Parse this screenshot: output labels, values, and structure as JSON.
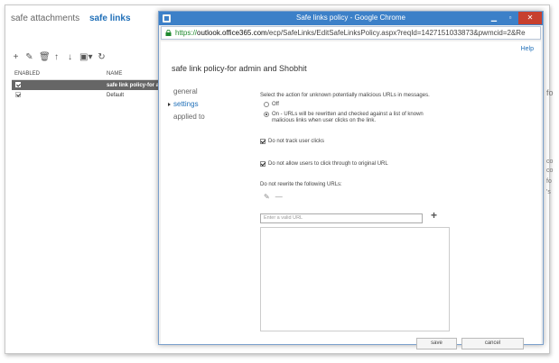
{
  "background": {
    "tabs": [
      "safe attachments",
      "safe links"
    ],
    "toolbar_icons": [
      "add-icon",
      "edit-icon",
      "delete-icon",
      "move-up-icon",
      "move-down-icon",
      "save-icon",
      "refresh-icon"
    ],
    "columns": [
      "ENABLED",
      "NAME"
    ],
    "rows": [
      {
        "enabled": true,
        "name": "safe link policy-for ad"
      },
      {
        "enabled": true,
        "name": "Default"
      }
    ],
    "right_edge_text": [
      "fo",
      "co",
      "co",
      "fo",
      "'s"
    ]
  },
  "window": {
    "title": "Safe links policy - Google Chrome",
    "buttons": [
      "minimize",
      "maximize",
      "close"
    ],
    "url_scheme": "https://",
    "url_host": "outlook.office365.com",
    "url_rest": "/ecp/SafeLinks/EditSafeLinksPolicy.aspx?reqId=1427151033873&pwmcid=2&Re"
  },
  "page": {
    "help": "Help",
    "heading": "safe link policy-for admin and Shobhit",
    "nav": [
      "general",
      "settings",
      "applied to"
    ],
    "nav_active": 1,
    "action_label": "Select the action for unknown potentially malicious URLs in messages.",
    "radio_off": "Off",
    "radio_on_line1": "On - URLs will be rewritten and checked against a list of known",
    "radio_on_line2": "malicious links when user clicks on the link.",
    "cb_track": "Do not track user clicks",
    "cb_click": "Do not allow users to click through to original URL",
    "rewrite_label": "Do not rewrite the following URLs:",
    "url_placeholder": "Enter a valid URL",
    "save": "save",
    "cancel": "cancel"
  },
  "colors": {
    "accent": "#1f6fb8",
    "titlebar": "#3c80c8",
    "close": "#c7402f"
  }
}
